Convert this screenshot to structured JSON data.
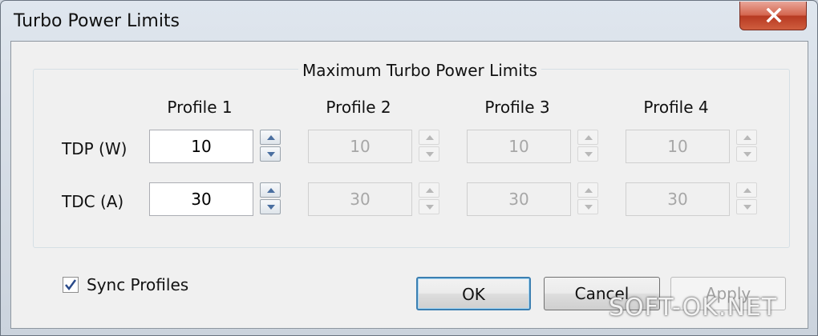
{
  "window": {
    "title": "Turbo Power Limits",
    "close_label": "×"
  },
  "group": {
    "title": "Maximum Turbo Power Limits"
  },
  "profiles": [
    {
      "name": "Profile 1",
      "tdp": "10",
      "tdc": "30",
      "enabled": true
    },
    {
      "name": "Profile 2",
      "tdp": "10",
      "tdc": "30",
      "enabled": false
    },
    {
      "name": "Profile 3",
      "tdp": "10",
      "tdc": "30",
      "enabled": false
    },
    {
      "name": "Profile 4",
      "tdp": "10",
      "tdc": "30",
      "enabled": false
    }
  ],
  "rows": {
    "tdp_label": "TDP (W)",
    "tdc_label": "TDC (A)"
  },
  "sync": {
    "label": "Sync Profiles",
    "checked": true
  },
  "buttons": {
    "ok": "OK",
    "cancel": "Cancel",
    "apply": "Apply"
  },
  "watermark": {
    "text": "SOFT-OK.NET"
  },
  "colors": {
    "default_button_border": "#3c7fb1",
    "close_button": "#c4482f",
    "disabled_text": "#a7a7a7"
  }
}
